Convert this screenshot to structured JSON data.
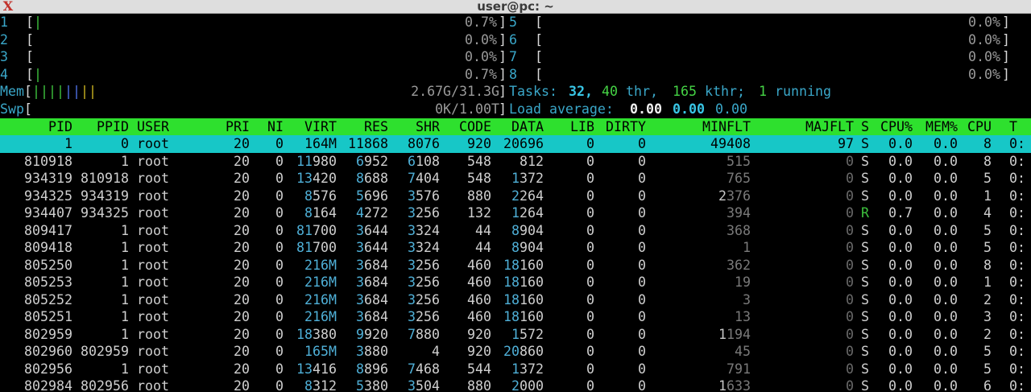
{
  "window": {
    "title": "user@pc: ~",
    "icon": "x-terminal-icon"
  },
  "cpu_meters": [
    {
      "id": "1",
      "bar": "|",
      "value": "0.7%"
    },
    {
      "id": "2",
      "bar": "",
      "value": "0.0%"
    },
    {
      "id": "3",
      "bar": "",
      "value": "0.0%"
    },
    {
      "id": "4",
      "bar": "|",
      "value": "0.7%"
    },
    {
      "id": "5",
      "bar": "",
      "value": "0.0%"
    },
    {
      "id": "6",
      "bar": "",
      "value": "0.0%"
    },
    {
      "id": "7",
      "bar": "",
      "value": "0.0%"
    },
    {
      "id": "8",
      "bar": "",
      "value": "0.0%"
    }
  ],
  "mem": {
    "label": "Mem",
    "bar_green": "||||",
    "bar_blue": "||",
    "bar_yellow": "||",
    "value": "2.67G/31.3G"
  },
  "swp": {
    "label": "Swp",
    "value": "0K/1.00T"
  },
  "tasks": {
    "label": "Tasks:",
    "tasks": "32",
    "thr": "40",
    "thr_label": "thr,",
    "kthr": "165",
    "kthr_label": "kthr;",
    "running": "1",
    "running_label": "running"
  },
  "load": {
    "label": "Load average:",
    "l1": "0.00",
    "l5": "0.00",
    "l15": "0.00"
  },
  "columns": [
    "PID",
    "PPID",
    "USER",
    "PRI",
    "NI",
    "VIRT",
    "RES",
    "SHR",
    "CODE",
    "DATA",
    "LIB",
    "DIRTY",
    "MINFLT",
    "MAJFLT",
    "S",
    "CPU%",
    "MEM%",
    "CPU",
    "T"
  ],
  "processes": [
    {
      "pid": "1",
      "ppid": "0",
      "user": "root",
      "pri": "20",
      "ni": "0",
      "virt": "164M",
      "res": "11868",
      "shr": "8076",
      "code": "920",
      "data": "20696",
      "lib": "0",
      "dirty": "0",
      "minflt": "49408",
      "majflt": "97",
      "s": "S",
      "cpu": "0.0",
      "mem": "0.0",
      "cpun": "8",
      "t": "0:"
    },
    {
      "pid": "810918",
      "ppid": "1",
      "user": "root",
      "pri": "20",
      "ni": "0",
      "virt": "11980",
      "res": "6952",
      "shr": "6108",
      "code": "548",
      "data": "812",
      "lib": "0",
      "dirty": "0",
      "minflt": "515",
      "majflt": "0",
      "s": "S",
      "cpu": "0.0",
      "mem": "0.0",
      "cpun": "8",
      "t": "0:"
    },
    {
      "pid": "934319",
      "ppid": "810918",
      "user": "root",
      "pri": "20",
      "ni": "0",
      "virt": "13420",
      "res": "8688",
      "shr": "7404",
      "code": "548",
      "data": "1372",
      "lib": "0",
      "dirty": "0",
      "minflt": "765",
      "majflt": "0",
      "s": "S",
      "cpu": "0.0",
      "mem": "0.0",
      "cpun": "5",
      "t": "0:"
    },
    {
      "pid": "934325",
      "ppid": "934319",
      "user": "root",
      "pri": "20",
      "ni": "0",
      "virt": "8576",
      "res": "5696",
      "shr": "3576",
      "code": "880",
      "data": "2264",
      "lib": "0",
      "dirty": "0",
      "minflt": "2376",
      "majflt": "0",
      "s": "S",
      "cpu": "0.0",
      "mem": "0.0",
      "cpun": "1",
      "t": "0:"
    },
    {
      "pid": "934407",
      "ppid": "934325",
      "user": "root",
      "pri": "20",
      "ni": "0",
      "virt": "8164",
      "res": "4272",
      "shr": "3256",
      "code": "132",
      "data": "1264",
      "lib": "0",
      "dirty": "0",
      "minflt": "394",
      "majflt": "0",
      "s": "R",
      "cpu": "0.7",
      "mem": "0.0",
      "cpun": "4",
      "t": "0:"
    },
    {
      "pid": "809417",
      "ppid": "1",
      "user": "root",
      "pri": "20",
      "ni": "0",
      "virt": "81700",
      "res": "3644",
      "shr": "3324",
      "code": "44",
      "data": "8904",
      "lib": "0",
      "dirty": "0",
      "minflt": "368",
      "majflt": "0",
      "s": "S",
      "cpu": "0.0",
      "mem": "0.0",
      "cpun": "5",
      "t": "0:"
    },
    {
      "pid": "809418",
      "ppid": "1",
      "user": "root",
      "pri": "20",
      "ni": "0",
      "virt": "81700",
      "res": "3644",
      "shr": "3324",
      "code": "44",
      "data": "8904",
      "lib": "0",
      "dirty": "0",
      "minflt": "1",
      "majflt": "0",
      "s": "S",
      "cpu": "0.0",
      "mem": "0.0",
      "cpun": "5",
      "t": "0:"
    },
    {
      "pid": "805250",
      "ppid": "1",
      "user": "root",
      "pri": "20",
      "ni": "0",
      "virt": "216M",
      "res": "3684",
      "shr": "3256",
      "code": "460",
      "data": "18160",
      "lib": "0",
      "dirty": "0",
      "minflt": "362",
      "majflt": "0",
      "s": "S",
      "cpu": "0.0",
      "mem": "0.0",
      "cpun": "8",
      "t": "0:"
    },
    {
      "pid": "805253",
      "ppid": "1",
      "user": "root",
      "pri": "20",
      "ni": "0",
      "virt": "216M",
      "res": "3684",
      "shr": "3256",
      "code": "460",
      "data": "18160",
      "lib": "0",
      "dirty": "0",
      "minflt": "19",
      "majflt": "0",
      "s": "S",
      "cpu": "0.0",
      "mem": "0.0",
      "cpun": "1",
      "t": "0:"
    },
    {
      "pid": "805252",
      "ppid": "1",
      "user": "root",
      "pri": "20",
      "ni": "0",
      "virt": "216M",
      "res": "3684",
      "shr": "3256",
      "code": "460",
      "data": "18160",
      "lib": "0",
      "dirty": "0",
      "minflt": "3",
      "majflt": "0",
      "s": "S",
      "cpu": "0.0",
      "mem": "0.0",
      "cpun": "2",
      "t": "0:"
    },
    {
      "pid": "805251",
      "ppid": "1",
      "user": "root",
      "pri": "20",
      "ni": "0",
      "virt": "216M",
      "res": "3684",
      "shr": "3256",
      "code": "460",
      "data": "18160",
      "lib": "0",
      "dirty": "0",
      "minflt": "13",
      "majflt": "0",
      "s": "S",
      "cpu": "0.0",
      "mem": "0.0",
      "cpun": "3",
      "t": "0:"
    },
    {
      "pid": "802959",
      "ppid": "1",
      "user": "root",
      "pri": "20",
      "ni": "0",
      "virt": "18380",
      "res": "9920",
      "shr": "7880",
      "code": "920",
      "data": "1572",
      "lib": "0",
      "dirty": "0",
      "minflt": "1194",
      "majflt": "0",
      "s": "S",
      "cpu": "0.0",
      "mem": "0.0",
      "cpun": "2",
      "t": "0:"
    },
    {
      "pid": "802960",
      "ppid": "802959",
      "user": "root",
      "pri": "20",
      "ni": "0",
      "virt": "165M",
      "res": "3880",
      "shr": "4",
      "code": "920",
      "data": "20860",
      "lib": "0",
      "dirty": "0",
      "minflt": "45",
      "majflt": "0",
      "s": "S",
      "cpu": "0.0",
      "mem": "0.0",
      "cpun": "5",
      "t": "0:"
    },
    {
      "pid": "802956",
      "ppid": "1",
      "user": "root",
      "pri": "20",
      "ni": "0",
      "virt": "13416",
      "res": "8896",
      "shr": "7468",
      "code": "544",
      "data": "1372",
      "lib": "0",
      "dirty": "0",
      "minflt": "791",
      "majflt": "0",
      "s": "S",
      "cpu": "0.0",
      "mem": "0.0",
      "cpun": "5",
      "t": "0:"
    },
    {
      "pid": "802984",
      "ppid": "802956",
      "user": "root",
      "pri": "20",
      "ni": "0",
      "virt": "8312",
      "res": "5380",
      "shr": "3504",
      "code": "880",
      "data": "2000",
      "lib": "0",
      "dirty": "0",
      "minflt": "1633",
      "majflt": "0",
      "s": "S",
      "cpu": "0.0",
      "mem": "0.0",
      "cpun": "6",
      "t": "0:"
    }
  ]
}
